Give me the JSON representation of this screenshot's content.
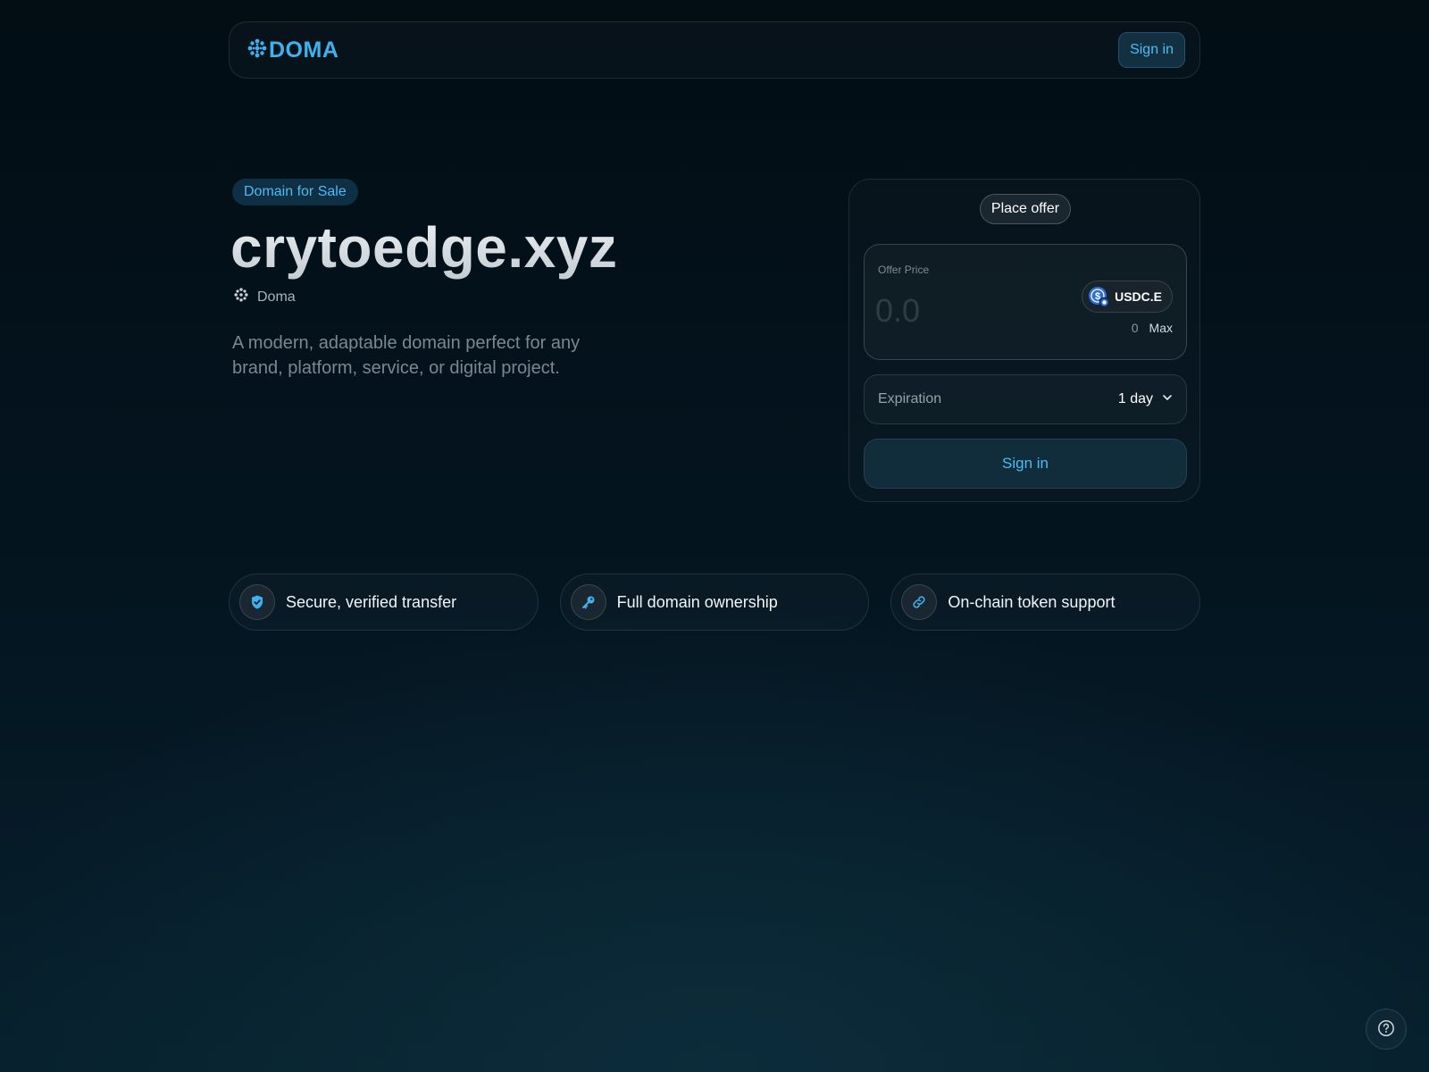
{
  "header": {
    "logo_text": "DOMA",
    "sign_in_label": "Sign in"
  },
  "listing": {
    "badge": "Domain for Sale",
    "domain": "crytoedge.xyz",
    "registrar": "Doma",
    "description": "A modern, adaptable domain perfect for any brand, platform, service, or digital project."
  },
  "offer": {
    "tab_label": "Place offer",
    "price_label": "Offer Price",
    "price_placeholder": "0.0",
    "token": "USDC.E",
    "balance": "0",
    "max_label": "Max",
    "expiration_label": "Expiration",
    "expiration_value": "1 day",
    "submit_label": "Sign in"
  },
  "features": [
    {
      "label": "Secure, verified transfer",
      "icon": "shield-check-icon"
    },
    {
      "label": "Full domain ownership",
      "icon": "key-icon"
    },
    {
      "label": "On-chain token support",
      "icon": "link-icon"
    }
  ],
  "colors": {
    "accent": "#3fb2ee",
    "background": "#031119",
    "badge_bg": "#0f2f44"
  },
  "help": {
    "icon": "help-circle-icon"
  }
}
